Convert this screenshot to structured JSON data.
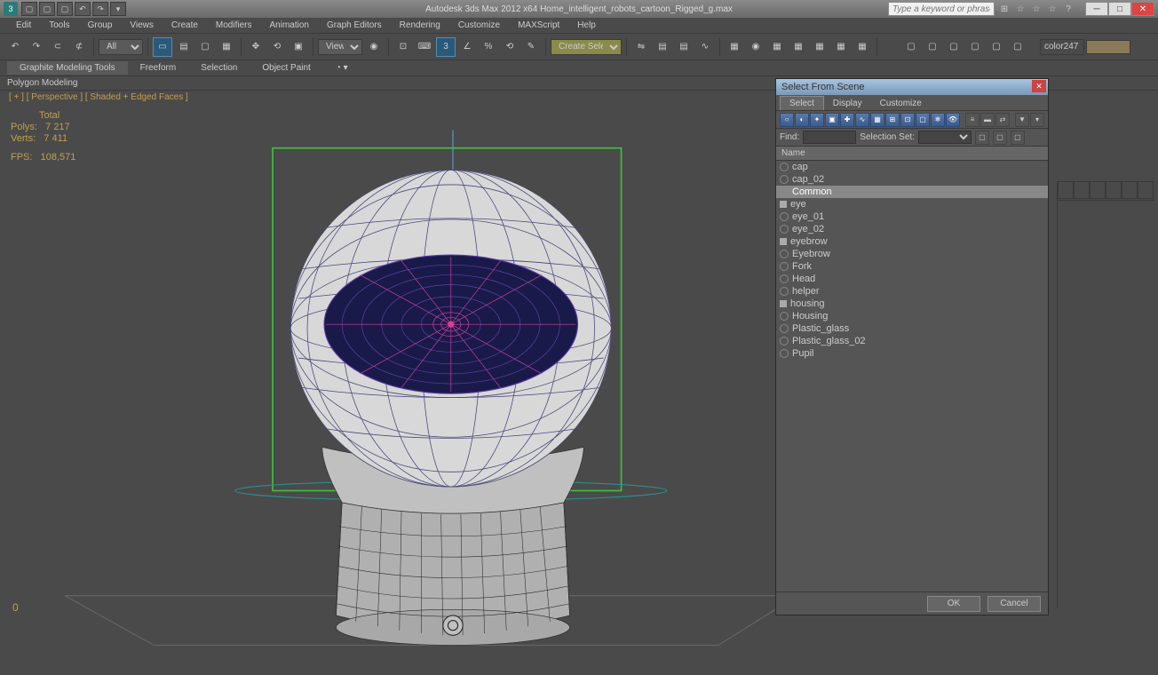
{
  "titlebar": {
    "app_title": "Autodesk 3ds Max 2012 x64     Home_intelligent_robots_cartoon_Rigged_g.max",
    "search_placeholder": "Type a keyword or phrase"
  },
  "menubar": {
    "items": [
      "Edit",
      "Tools",
      "Group",
      "Views",
      "Create",
      "Modifiers",
      "Animation",
      "Graph Editors",
      "Rendering",
      "Customize",
      "MAXScript",
      "Help"
    ]
  },
  "toolbar": {
    "filter_label": "All",
    "view_label": "View",
    "selset_label": "Create Selection Se",
    "color_label": "color247"
  },
  "ribbon": {
    "tabs": [
      "Graphite Modeling Tools",
      "Freeform",
      "Selection",
      "Object Paint"
    ],
    "sub": "Polygon Modeling"
  },
  "viewport": {
    "label": "[ + ] [ Perspective ] [ Shaded + Edged Faces ]",
    "stats_header": "Total",
    "polys_label": "Polys:",
    "polys_value": "7 217",
    "verts_label": "Verts:",
    "verts_value": "7 411",
    "fps_label": "FPS:",
    "fps_value": "108,571",
    "corner": "0"
  },
  "dialog": {
    "title": "Select From Scene",
    "tabs": [
      "Select",
      "Display",
      "Customize"
    ],
    "find_label": "Find:",
    "selset_label": "Selection Set:",
    "name_header": "Name",
    "items": [
      {
        "name": "cap",
        "type": "geo"
      },
      {
        "name": "cap_02",
        "type": "geo"
      },
      {
        "name": "Common",
        "type": "geo",
        "selected": true
      },
      {
        "name": "eye",
        "type": "bone"
      },
      {
        "name": "eye_01",
        "type": "geo"
      },
      {
        "name": "eye_02",
        "type": "geo"
      },
      {
        "name": "eyebrow",
        "type": "bone"
      },
      {
        "name": "Eyebrow",
        "type": "geo"
      },
      {
        "name": "Fork",
        "type": "geo"
      },
      {
        "name": "Head",
        "type": "geo"
      },
      {
        "name": "helper",
        "type": "geo"
      },
      {
        "name": "housing",
        "type": "bone"
      },
      {
        "name": "Housing",
        "type": "geo"
      },
      {
        "name": "Plastic_glass",
        "type": "geo"
      },
      {
        "name": "Plastic_glass_02",
        "type": "geo"
      },
      {
        "name": "Pupil",
        "type": "geo"
      }
    ],
    "ok": "OK",
    "cancel": "Cancel"
  }
}
